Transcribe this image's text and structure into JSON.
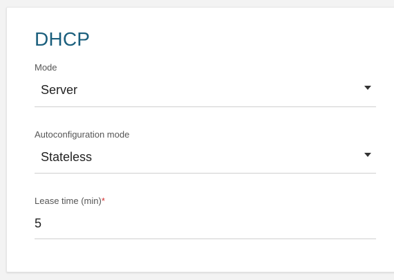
{
  "section": {
    "title": "DHCP"
  },
  "fields": {
    "mode": {
      "label": "Mode",
      "value": "Server"
    },
    "autoconfiguration_mode": {
      "label": "Autoconfiguration mode",
      "value": "Stateless"
    },
    "lease_time": {
      "label": "Lease time (min)",
      "required_marker": "*",
      "value": "5"
    }
  },
  "colors": {
    "title": "#1b5f7d",
    "required": "#d32f2f",
    "underline": "#cfcfcf",
    "background": "#f3f3f3",
    "card": "#ffffff"
  },
  "icons": {
    "dropdown": "triangle-down-icon"
  }
}
